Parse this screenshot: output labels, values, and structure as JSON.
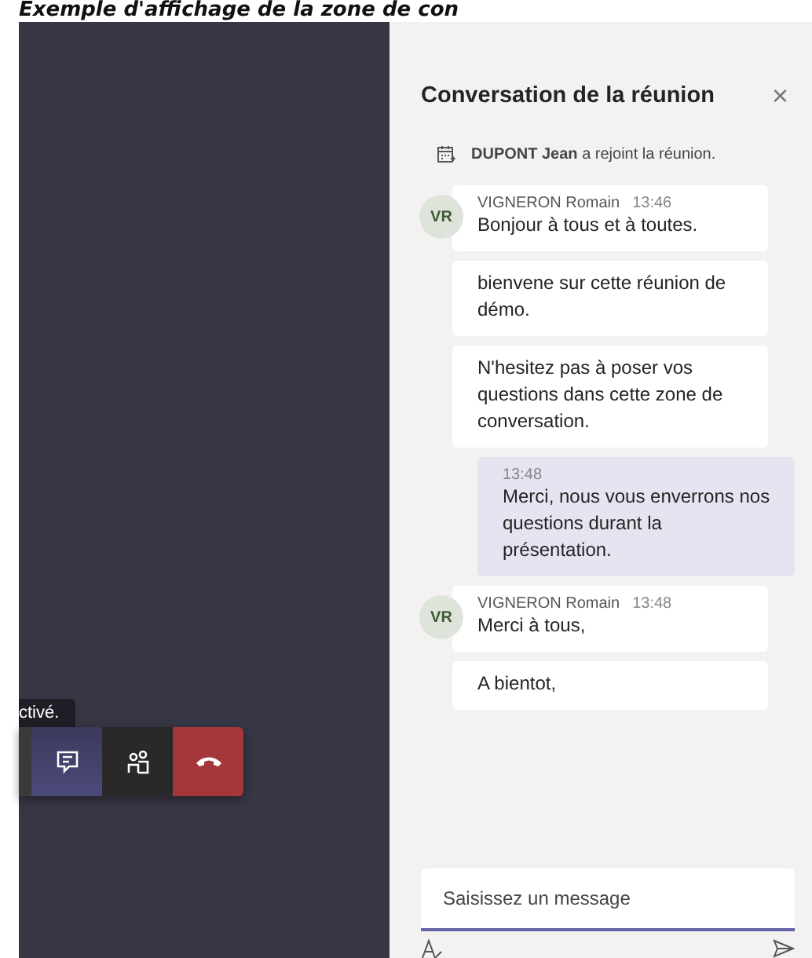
{
  "caption": "Exemple d'affichage de la zone de con",
  "call": {
    "tooltip": "ctivé.",
    "controls": [
      {
        "kind": "partial",
        "selected": false
      },
      {
        "kind": "chat",
        "selected": true
      },
      {
        "kind": "people",
        "selected": false
      },
      {
        "kind": "hangup",
        "selected": false
      }
    ]
  },
  "chat": {
    "title": "Conversation de la réunion",
    "close": "×",
    "messages": [
      {
        "kind": "system",
        "text": "**DUPONT Jean** a rejoint la réunion."
      },
      {
        "kind": "incoming",
        "avatar": "VR",
        "author": "VIGNERON Romain",
        "time": "13:46",
        "text": "Bonjour à tous et à toutes."
      },
      {
        "kind": "incoming",
        "text": "bienvene sur cette réunion de démo."
      },
      {
        "kind": "incoming",
        "text": "N'hesitez pas à poser vos questions dans cette zone de conversation."
      },
      {
        "kind": "outgoing",
        "time": "13:48",
        "text": "Merci, nous vous enverrons nos questions durant la présentation."
      },
      {
        "kind": "incoming",
        "avatar": "VR",
        "author": "VIGNERON Romain",
        "time": "13:48",
        "text": "Merci à tous,"
      },
      {
        "kind": "incoming",
        "text": "A bientot,"
      }
    ],
    "compose": {
      "placeholder": "Saisissez un message"
    }
  }
}
